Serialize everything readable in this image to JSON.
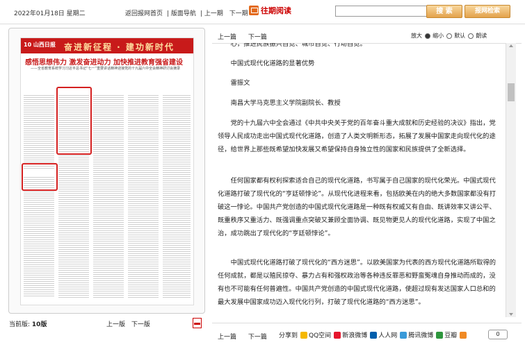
{
  "header": {
    "date": "2022年01月18日 星期二",
    "nav": [
      "返回报网首页",
      "版面导航",
      "上一期",
      "下一期"
    ],
    "past_reading": "往期阅读",
    "search_placeholder": "",
    "search_button": "搜 索",
    "all_search_button": "报网检索"
  },
  "newspaper": {
    "masthead_logo": "10 山西日报",
    "slogan": "奋进新征程 · 建功新时代",
    "headline": "感悟思想伟力 激发奋进动力 加快推进教育强省建设",
    "subhead": "——全省教育系统学习习近平总书记“七一”重要讲话精神迎接党的十九届六中全会精神研讨会摘录"
  },
  "left_footer": {
    "current_label": "当前版:",
    "current_value": "10版",
    "prev": "上一版",
    "next": "下一版"
  },
  "article_toolbar": {
    "prev": "上一篇",
    "next": "下一篇",
    "zoom_label": "放大",
    "zoom_small": "缩小",
    "zoom_default": "默认",
    "read_aloud": "朗读"
  },
  "article": {
    "paragraphs": [
      "心，推进民族振兴自觉、城市自觉、行动自觉。",
      "中国式现代化道路的显著优势",
      "雷振文",
      "南昌大学马克思主义学院副院长、教授",
      "党的十九届六中全会通过《中共中央关于党的百年奋斗重大成就和历史经验的决议》指出，党领导人民成功走出中国式现代化道路，创造了人类文明新形态，拓展了发展中国家走向现代化的途径，给世界上那些既希望加快发展又希望保持自身独立性的国家和民族提供了全新选择。",
      "任何国家都有权利探索适合自己的现代化道路，书写属于自己国家的现代化荣光。中国式现代化道路打破了现代化的“亨廷顿悖论”。从现代化进程来看，包括欧美在内的绝大多数国家都没有打破这一悖论。中国共产党创造的中国式现代化道路是一种既有权威又有自由、既讲效率又讲公平、既重秩序又重活力、既强调重点突破又兼顾全面协调、既见物更见人的现代化道路，实现了中国之治，成功跳出了现代化的“亨廷顿悖论”。",
      "中国式现代化道路打破了现代化的“西方迷思”。以欧美国家为代表的西方现代化道路所取得的任何成就，都是以殖民掠夺、暴力占有和强权政治等各种违反罪恶和野蛮冤魂自身推动而成的，没有也不可能有任何普遍性。中国共产党创造的中国式现代化道路，使超过现有发达国家人口总和的最大发展中国家成功迈入现代化行列，打破了现代化道路的“西方迷思”。"
    ]
  },
  "bottom": {
    "prev": "上一篇",
    "next": "下一篇",
    "share_label": "分享到",
    "share_items": [
      {
        "name": "QQ空间",
        "color": "#f5b800"
      },
      {
        "name": "新浪微博",
        "color": "#e6162d"
      },
      {
        "name": "人人网",
        "color": "#005eac"
      },
      {
        "name": "腾讯微博",
        "color": "#3a9ad9"
      },
      {
        "name": "豆瓣",
        "color": "#2e963d"
      }
    ],
    "count": "0"
  }
}
